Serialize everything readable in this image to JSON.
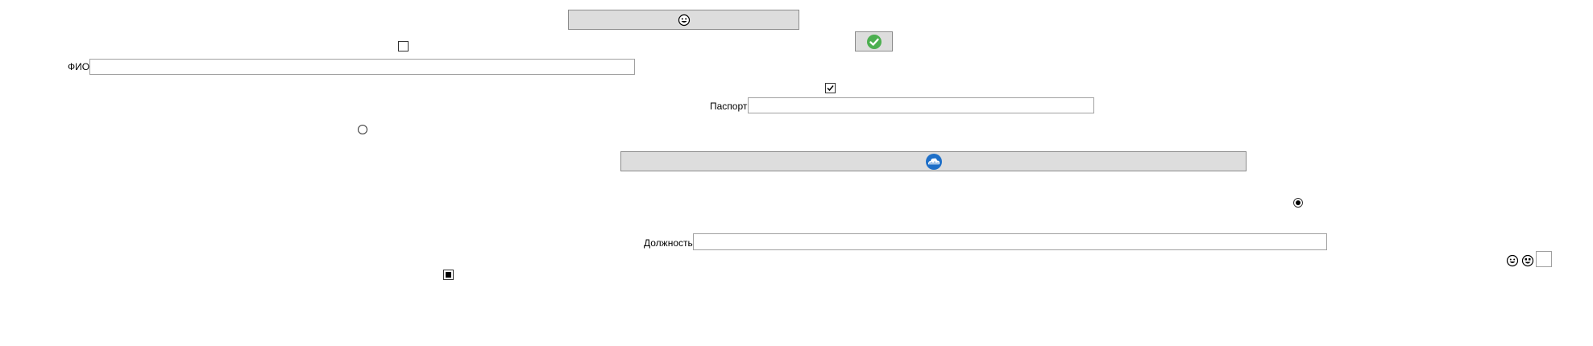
{
  "form": {
    "fio_label": "ФИО",
    "fio_value": "",
    "passport_label": "Паспорт",
    "passport_value": "",
    "position_label": "Должность",
    "position_value": "",
    "small_field_value": ""
  },
  "controls": {
    "checkbox_top_checked": false,
    "checkbox_passport_checked": true,
    "checkbox_bottom_state": "indeterminate",
    "radio_left_selected": false,
    "radio_right_selected": true
  },
  "icons": {
    "top_button_icon": "grinning-face-icon",
    "confirm_button_icon": "green-checkmark-icon",
    "wide_button_icon": "blue-cloud-icon",
    "small_icon_1": "grinning-face-icon",
    "small_icon_2": "smiley-face-icon"
  },
  "colors": {
    "button_bg": "#dddddd",
    "button_border": "#8c8c8c",
    "check_green": "#4caf50",
    "cloud_blue": "#1e6fc8"
  }
}
